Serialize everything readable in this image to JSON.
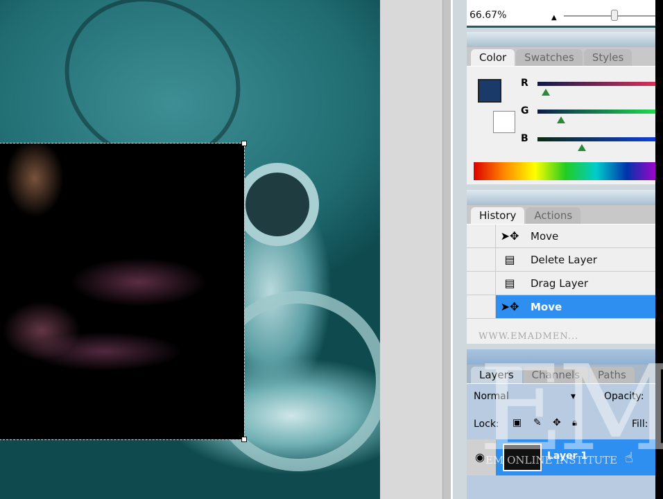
{
  "navigator": {
    "zoom": "66.67%"
  },
  "color_panel": {
    "tabs": [
      "Color",
      "Swatches",
      "Styles"
    ],
    "channels": [
      "R",
      "G",
      "B"
    ],
    "foreground": "#1a3a6a",
    "background": "#ffffff"
  },
  "history_panel": {
    "tabs": [
      "History",
      "Actions"
    ],
    "items": [
      {
        "label": "Move",
        "icon": "move-icon"
      },
      {
        "label": "Delete Layer",
        "icon": "layer-icon"
      },
      {
        "label": "Drag Layer",
        "icon": "layer-icon"
      },
      {
        "label": "Move",
        "icon": "move-icon",
        "selected": true
      }
    ]
  },
  "layers_panel": {
    "tabs": [
      "Layers",
      "Channels",
      "Paths"
    ],
    "blend_mode": "Normal",
    "opacity_label": "Opacity:",
    "lock_label": "Lock:",
    "fill_label": "Fill:",
    "layers": [
      {
        "name": "Layer 1",
        "selected": true
      }
    ]
  },
  "watermark": {
    "logo": "EM",
    "subtitle": "EM ONLINE INSTITUTE",
    "url": "WWW.EMADMEN..."
  }
}
